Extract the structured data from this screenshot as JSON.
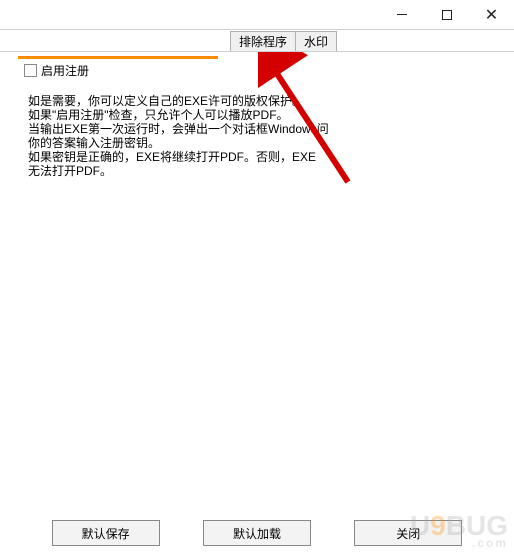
{
  "titlebar": {
    "min_icon": "minimize",
    "max_icon": "maximize",
    "close_icon": "close"
  },
  "tabs": {
    "exclude": "排除程序",
    "watermark": "水印"
  },
  "checkbox": {
    "label": "启用注册"
  },
  "help": {
    "line1": "如是需要，你可以定义自己的EXE许可的版权保护。",
    "line2": "如果\"启用注册\"检查，只允许个人可以播放PDF。",
    "line3": "当输出EXE第一次运行时，会弹出一个对话框Windows问",
    "line4": "你的答案输入注册密钥。",
    "line5": "如果密钥是正确的，EXE将继续打开PDF。否则，EXE",
    "line6": "无法打开PDF。"
  },
  "buttons": {
    "save": "默认保存",
    "load": "默认加载",
    "close": "关闭"
  },
  "watermark_overlay": {
    "prefix": "U",
    "mid": "9",
    "suffix": "BUG",
    "sub": ".com"
  }
}
